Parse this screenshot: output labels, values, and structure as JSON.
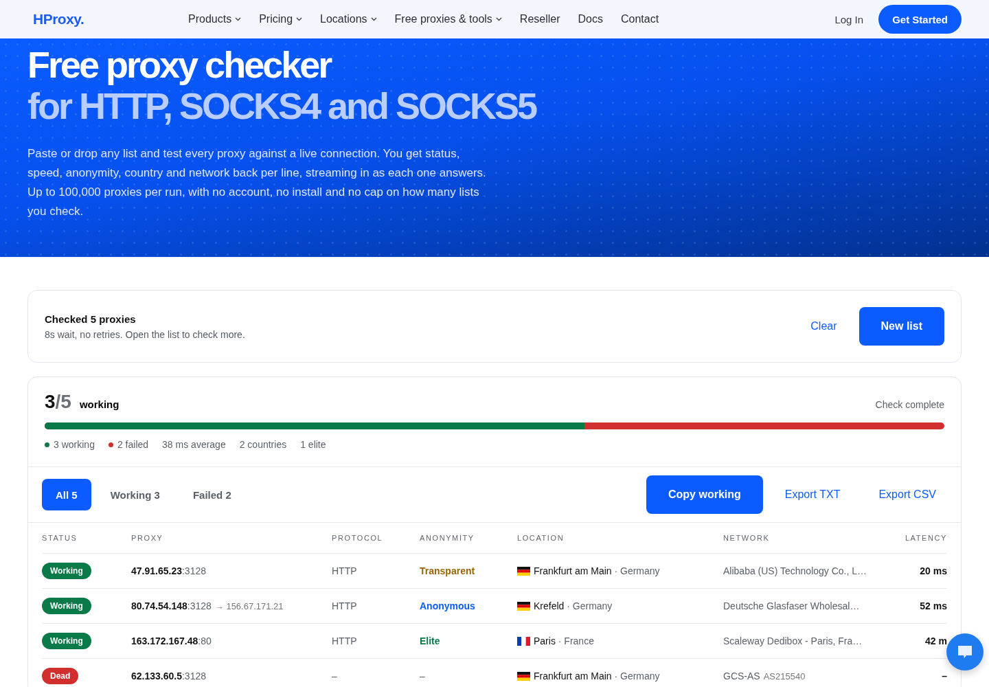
{
  "nav": {
    "logo": "HProxy.",
    "items": [
      {
        "label": "Products",
        "dropdown": true
      },
      {
        "label": "Pricing",
        "dropdown": true
      },
      {
        "label": "Locations",
        "dropdown": true
      },
      {
        "label": "Free proxies & tools",
        "dropdown": true
      },
      {
        "label": "Reseller",
        "dropdown": false
      },
      {
        "label": "Docs",
        "dropdown": false
      },
      {
        "label": "Contact",
        "dropdown": false
      }
    ],
    "login": "Log In",
    "cta": "Get Started"
  },
  "hero": {
    "title_line_1": "Free proxy checker",
    "title_line_2": "for HTTP, SOCKS4 and SOCKS5",
    "description": "Paste or drop any list and test every proxy against a live connection. You get status, speed, anonymity, country and network back per line, streaming in as each one answers. Up to 100,000 proxies per run, with no account, no install and no cap on how many lists you check."
  },
  "summary": {
    "title": "Checked 5 proxies",
    "subtitle": "8s wait, no retries. Open the list to check more.",
    "clear": "Clear",
    "new_list": "New list"
  },
  "results": {
    "count": "3",
    "total": "/5",
    "count_label": "working",
    "status": "Check complete",
    "progress": {
      "level": 0.6
    },
    "stats": [
      {
        "label": "3 working",
        "color": "#0a7a48"
      },
      {
        "label": "2 failed",
        "color": "#d12e2e"
      },
      {
        "label": "38 ms average"
      },
      {
        "label": "2 countries"
      },
      {
        "label": "1 elite"
      }
    ],
    "filters": [
      {
        "label": "All 5",
        "selected": true
      },
      {
        "label": "Working 3",
        "selected": false
      },
      {
        "label": "Failed 2",
        "selected": false
      }
    ],
    "actions": {
      "copy": "Copy working",
      "export_txt": "Export TXT",
      "export_csv": "Export CSV"
    }
  },
  "table": {
    "columns": [
      "STATUS",
      "PROXY",
      "PROTOCOL",
      "ANONYMITY",
      "LOCATION",
      "NETWORK",
      "LATENCY"
    ],
    "rows": [
      {
        "status": {
          "kind": "working",
          "label": "Working"
        },
        "host": "47.91.65.23",
        "port": ":3128",
        "protocol": "HTTP",
        "anonymity": {
          "kind": "transparent",
          "label": "Transparent"
        },
        "location": {
          "kind": "de",
          "city": "Frankfurt am Main",
          "country": "· Germany"
        },
        "network": "Alibaba (US) Technology Co., L…",
        "latency": "20 ms"
      },
      {
        "status": {
          "kind": "working",
          "label": "Working"
        },
        "host": "80.74.54.148",
        "port": ":3128",
        "exit": "→ 156.67.171.21",
        "protocol": "HTTP",
        "anonymity": {
          "kind": "anonymous",
          "label": "Anonymous"
        },
        "location": {
          "kind": "de",
          "city": "Krefeld",
          "country": "· Germany"
        },
        "network": "Deutsche Glasfaser Wholesal…",
        "latency": "52 ms"
      },
      {
        "status": {
          "kind": "working",
          "label": "Working"
        },
        "host": "163.172.167.48",
        "port": ":80",
        "protocol": "HTTP",
        "anonymity": {
          "kind": "elite",
          "label": "Elite"
        },
        "location": {
          "kind": "fr",
          "city": "Paris",
          "country": "· France"
        },
        "network": "Scaleway Dedibox - Paris, Fra…",
        "latency": "42 m"
      },
      {
        "status": {
          "kind": "dead",
          "label": "Dead"
        },
        "host": "62.133.60.5",
        "port": ":3128",
        "protocol": "–",
        "anonymity": {
          "kind": "none",
          "label": "–"
        },
        "location": {
          "kind": "de",
          "city": "Frankfurt am Main",
          "country": "· Germany"
        },
        "network": "GCS-AS",
        "asn": "AS215540",
        "latency": "–"
      }
    ]
  }
}
